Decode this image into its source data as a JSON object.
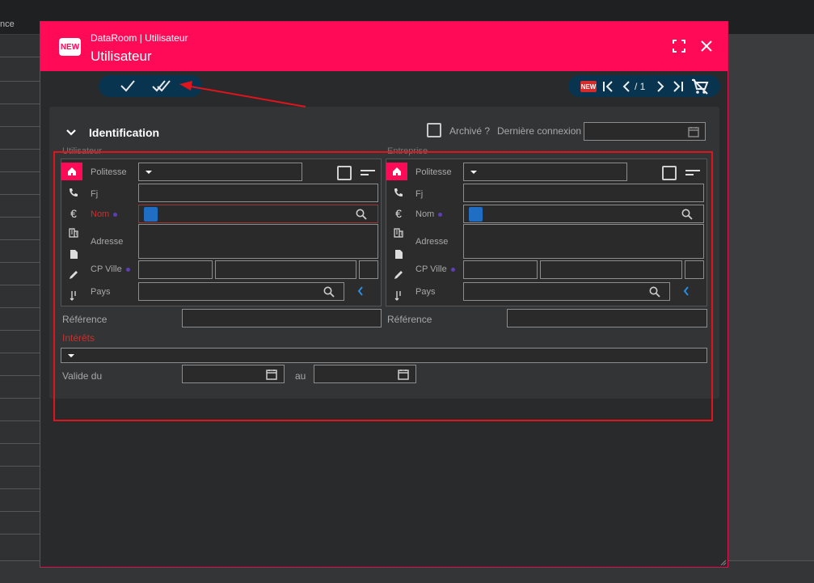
{
  "background": {
    "column_label": "nce"
  },
  "dialog": {
    "subtitle": "DataRoom | Utilisateur",
    "title": "Utilisateur",
    "logo_text": "NEW"
  },
  "toolbar_right": {
    "new_badge": "NEW",
    "pager": "/ 1"
  },
  "identification": {
    "section_title": "Identification",
    "archived_label": "Archivé ?",
    "last_login_label": "Dernière connexion",
    "last_login_value": ""
  },
  "utilisateur": {
    "group_label": "Utilisateur",
    "politesse_label": "Politesse",
    "fj_label": "Fj",
    "nom_label": "Nom",
    "adresse_label": "Adresse",
    "cpville_label": "CP Ville",
    "pays_label": "Pays",
    "reference_label": "Référence"
  },
  "entreprise": {
    "group_label": "Entreprise",
    "politesse_label": "Politesse",
    "fj_label": "Fj",
    "nom_label": "Nom",
    "adresse_label": "Adresse",
    "cpville_label": "CP Ville",
    "pays_label": "Pays",
    "reference_label": "Référence"
  },
  "interets": {
    "label": "Intérêts"
  },
  "validity": {
    "from_label": "Valide du",
    "to_label": "au"
  },
  "colors": {
    "accent": "#ff0a57",
    "toolbar": "#08344f",
    "annotation": "#e0141d"
  }
}
